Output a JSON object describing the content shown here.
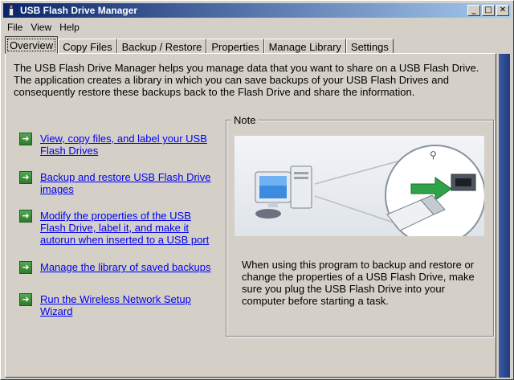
{
  "window": {
    "title": "USB Flash Drive Manager",
    "controls": {
      "minimize": "_",
      "maximize": "□",
      "close": "✕"
    }
  },
  "menu": [
    "File",
    "View",
    "Help"
  ],
  "tabs": [
    {
      "label": "Overview",
      "active": true
    },
    {
      "label": "Copy Files",
      "active": false
    },
    {
      "label": "Backup / Restore",
      "active": false
    },
    {
      "label": "Properties",
      "active": false
    },
    {
      "label": "Manage Library",
      "active": false
    },
    {
      "label": "Settings",
      "active": false
    }
  ],
  "overview": {
    "intro": "The USB Flash Drive Manager helps you manage data that you want to share on a USB Flash Drive. The application creates a library in which you can save backups of your USB Flash Drives and consequently restore these backups back to the Flash Drive and share the information.",
    "links": [
      {
        "label": "View, copy files, and label your USB Flash Drives",
        "icon": "green-arrow-icon"
      },
      {
        "label": "Backup and restore USB Flash Drive images",
        "icon": "green-arrow-icon"
      },
      {
        "label": "Modify the properties of the USB Flash Drive, label it, and make it autorun when inserted to a USB port",
        "icon": "green-arrow-icon"
      },
      {
        "label": "Manage the library of saved backups",
        "icon": "green-arrow-icon"
      },
      {
        "label": "Run the Wireless Network Setup Wizard",
        "icon": "green-arrow-icon"
      }
    ],
    "note": {
      "legend": "Note",
      "text": "When using this program to backup and restore or change the properties of a USB Flash Drive, make sure you plug the USB Flash Drive into your computer before starting a task."
    }
  },
  "colors": {
    "titlebar_start": "#0a246a",
    "titlebar_end": "#a6caf0",
    "face": "#d4d0c8",
    "link": "#0000ee",
    "arrow_green": "#3a8f3a"
  }
}
